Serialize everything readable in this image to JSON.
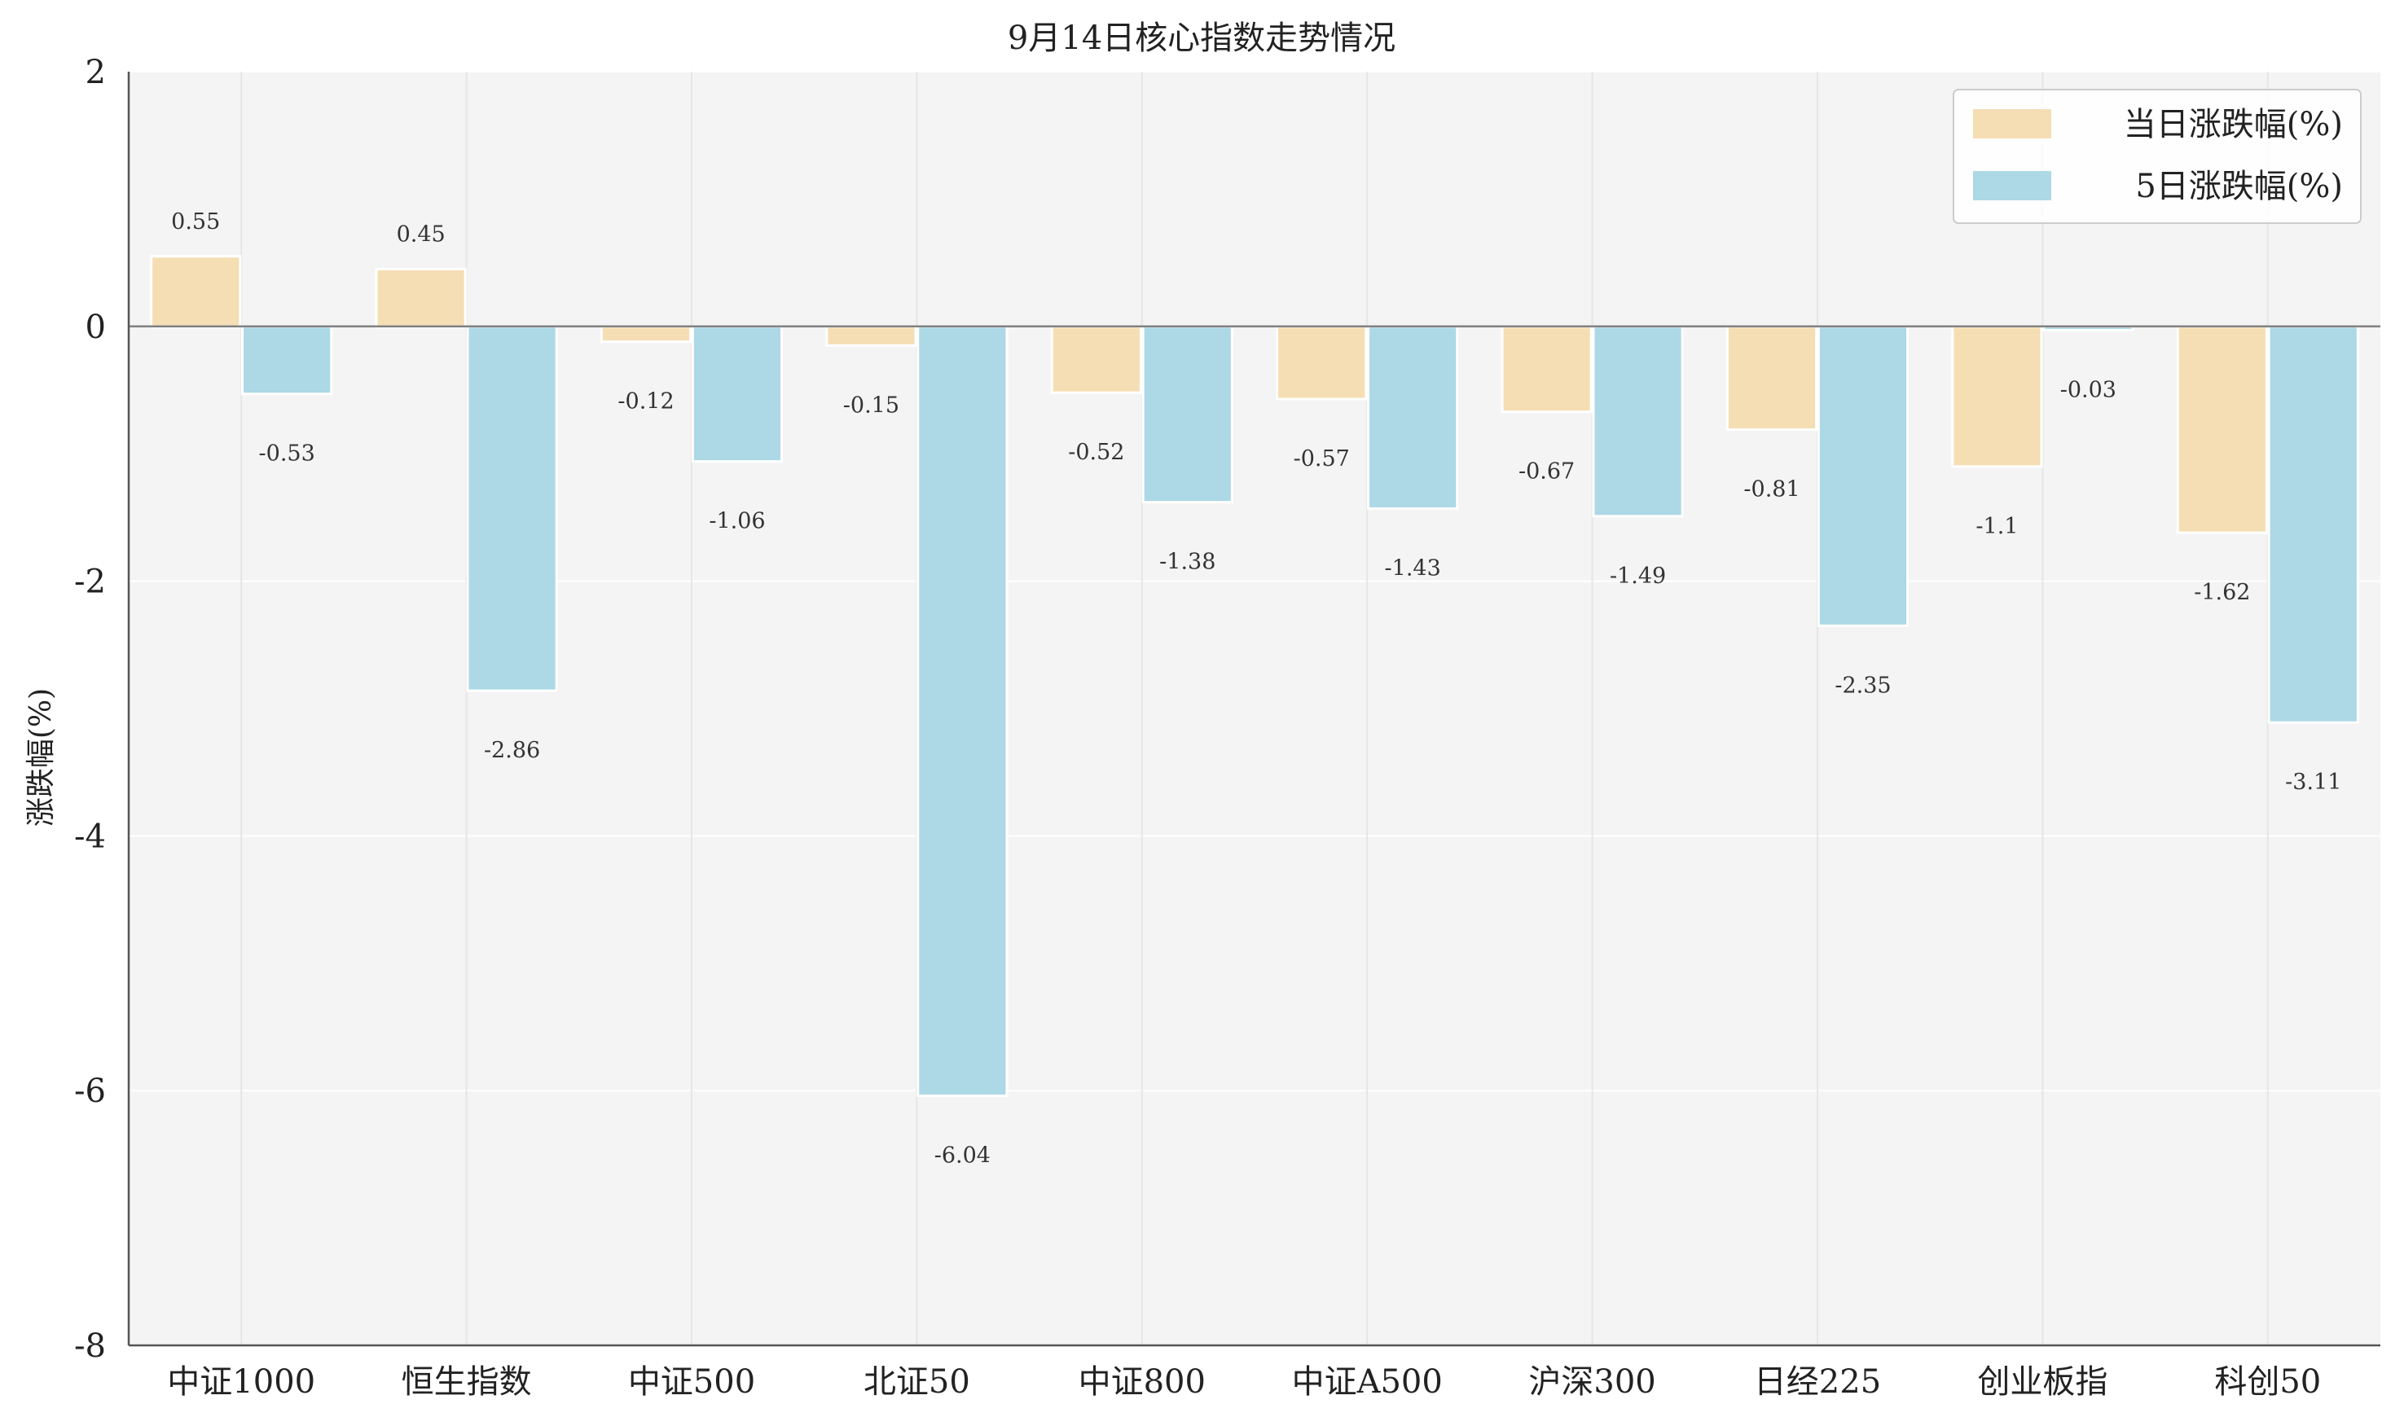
{
  "chart_data": {
    "type": "bar",
    "title": "9月14日核心指数走势情况",
    "ylabel": "涨跌幅(%)",
    "xlabel": "",
    "ylim": [
      -8,
      2
    ],
    "yticks": [
      2,
      0,
      -2,
      -4,
      -6,
      -8
    ],
    "grid": true,
    "legend_position": "top-right",
    "categories": [
      "中证1000",
      "恒生指数",
      "中证500",
      "北证50",
      "中证800",
      "中证A500",
      "沪深300",
      "日经225",
      "创业板指",
      "科创50"
    ],
    "series": [
      {
        "name": "当日涨跌幅(%)",
        "color": "#F5DEB3",
        "values": [
          0.55,
          0.45,
          -0.12,
          -0.15,
          -0.52,
          -0.57,
          -0.67,
          -0.81,
          -1.1,
          -1.62
        ]
      },
      {
        "name": "5日涨跌幅(%)",
        "color": "#ADD8E6",
        "values": [
          -0.53,
          -2.86,
          -1.06,
          -6.04,
          -1.38,
          -1.43,
          -1.49,
          -2.35,
          -0.03,
          -3.11
        ]
      }
    ]
  },
  "colors": {
    "plot_background": "#F4F4F4",
    "grid": "#FFFFFF",
    "zero_line": "#808080",
    "axis": "#555555"
  }
}
